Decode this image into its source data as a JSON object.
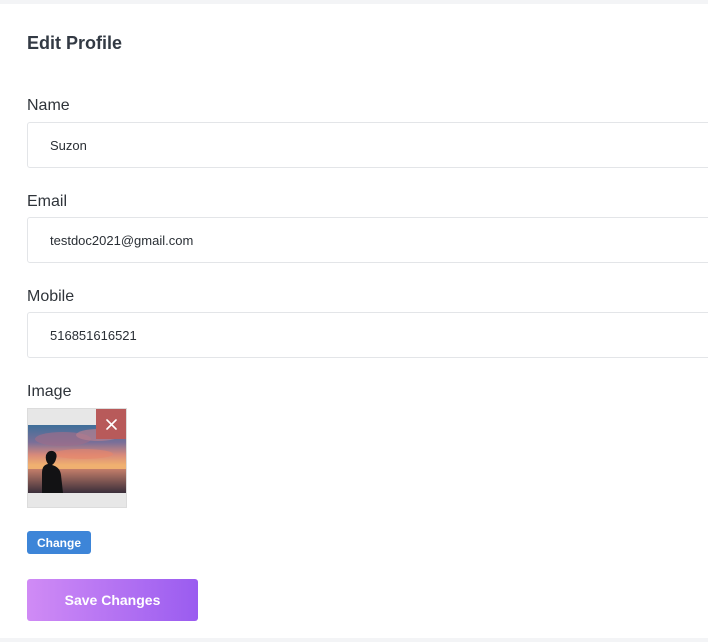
{
  "form": {
    "title": "Edit Profile",
    "fields": {
      "name": {
        "label": "Name",
        "value": "Suzon"
      },
      "email": {
        "label": "Email",
        "value": "testdoc2021@gmail.com"
      },
      "mobile": {
        "label": "Mobile",
        "value": "516851616521"
      }
    },
    "image": {
      "label": "Image",
      "remove_icon": "close-icon",
      "change_label": "Change"
    },
    "save_label": "Save Changes"
  },
  "colors": {
    "change_button": "#3d85d8",
    "save_gradient_start": "#d08bf5",
    "save_gradient_end": "#9a5cf0",
    "remove_button": "#b85a5a"
  }
}
